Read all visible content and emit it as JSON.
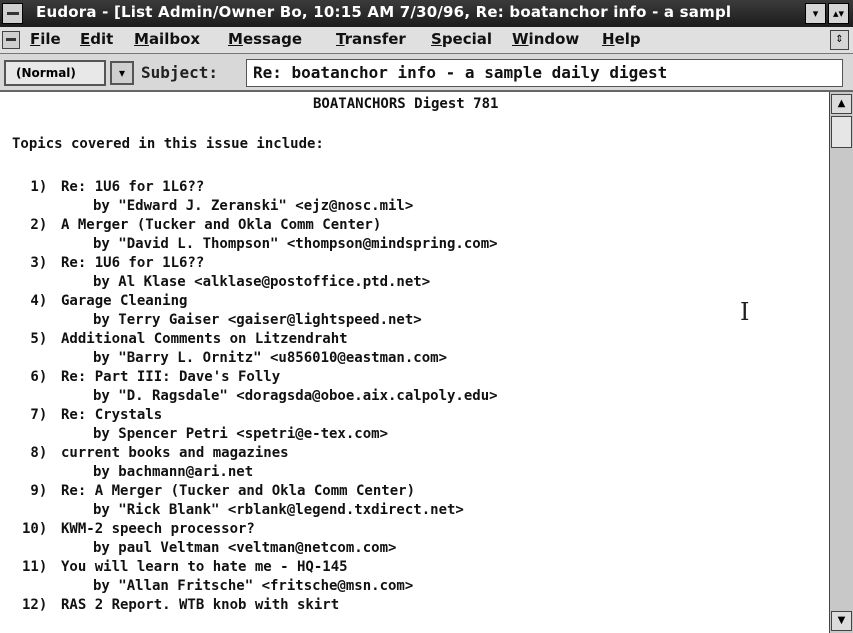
{
  "window": {
    "title": "Eudora - [List Admin/Owner Bo, 10:15 AM 7/30/96, Re: boatanchor info - a sampl",
    "minimize_icon": "▾",
    "maximize_icon": "▴▾"
  },
  "menu": {
    "items": [
      "File",
      "Edit",
      "Mailbox",
      "Message",
      "Transfer",
      "Special",
      "Window",
      "Help"
    ]
  },
  "toolbar": {
    "priority_value": "(Normal)",
    "priority_arrow": "▾",
    "subject_label": "Subject:",
    "subject_value": "Re: boatanchor info - a sample daily digest"
  },
  "message": {
    "digest_title": "BOATANCHORS Digest 781",
    "intro": "Topics covered in this issue include:",
    "topics": [
      {
        "num": " 1)",
        "subject": "Re: 1U6 for 1L6??",
        "by": "by \"Edward J. Zeranski\" <ejz@nosc.mil>"
      },
      {
        "num": " 2)",
        "subject": "A Merger (Tucker and Okla Comm Center)",
        "by": "by \"David L. Thompson\" <thompson@mindspring.com>"
      },
      {
        "num": " 3)",
        "subject": "Re: 1U6 for 1L6??",
        "by": "by Al Klase <alklase@postoffice.ptd.net>"
      },
      {
        "num": " 4)",
        "subject": "Garage Cleaning",
        "by": "by Terry Gaiser <gaiser@lightspeed.net>"
      },
      {
        "num": " 5)",
        "subject": "Additional Comments on Litzendraht",
        "by": "by \"Barry L. Ornitz\" <u856010@eastman.com>"
      },
      {
        "num": " 6)",
        "subject": "Re: Part III: Dave's Folly",
        "by": "by \"D. Ragsdale\" <doragsda@oboe.aix.calpoly.edu>"
      },
      {
        "num": " 7)",
        "subject": "Re: Crystals",
        "by": "by Spencer Petri <spetri@e-tex.com>"
      },
      {
        "num": " 8)",
        "subject": "current books and magazines",
        "by": "by bachmann@ari.net"
      },
      {
        "num": " 9)",
        "subject": "Re: A Merger (Tucker and Okla Comm Center)",
        "by": "by \"Rick Blank\" <rblank@legend.txdirect.net>"
      },
      {
        "num": "10)",
        "subject": "KWM-2 speech processor?",
        "by": "by paul Veltman <veltman@netcom.com>"
      },
      {
        "num": "11)",
        "subject": "You will learn to hate me - HQ-145",
        "by": "by \"Allan Fritsche\" <fritsche@msn.com>"
      },
      {
        "num": "12)",
        "subject": "RAS 2 Report. WTB knob with skirt",
        "by": ""
      }
    ]
  },
  "scrollbar": {
    "up_icon": "▲",
    "down_icon": "▼"
  }
}
